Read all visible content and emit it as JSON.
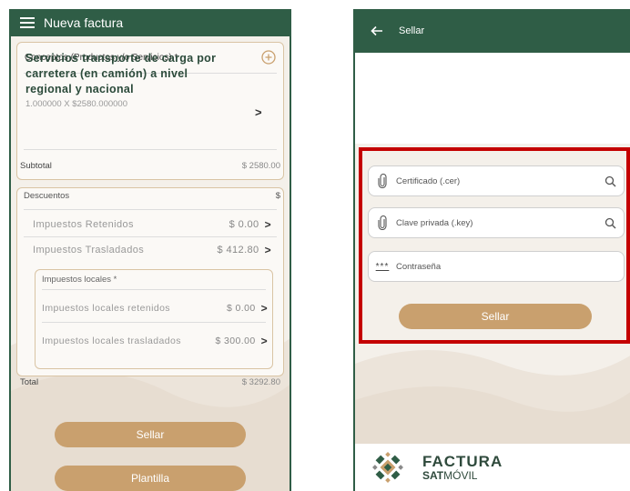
{
  "left": {
    "appbar": {
      "title": "Nueva factura",
      "menu_icon": "hamburger-menu-icon"
    },
    "concepts": {
      "header": "Conceptos (Productos y/o Servicios) *",
      "item_description": "Servicios transporte de carga por carretera (en camión) a nivel regional y nacional",
      "item_quantity_price": "1.000000 X $2580.000000"
    },
    "subtotal": {
      "label": "Subtotal",
      "value": "$ 2580.00"
    },
    "descuentos": {
      "label": "Descuentos",
      "value": "$"
    },
    "impuestos_retenidos": {
      "label": "Impuestos Retenidos",
      "value": "$ 0.00"
    },
    "impuestos_trasladados": {
      "label": "Impuestos Trasladados",
      "value": "$ 412.80"
    },
    "impuestos_locales": {
      "header": "Impuestos locales *",
      "retenidos_label": "Impuestos locales retenidos",
      "retenidos_value": "$ 0.00",
      "trasladados_label": "Impuestos locales trasladados",
      "trasladados_value": "$ 300.00"
    },
    "total": {
      "label": "Total",
      "value": "$ 3292.80"
    },
    "buttons": {
      "sellar": "Sellar",
      "plantilla": "Plantilla"
    }
  },
  "right": {
    "appbar": {
      "title": "Sellar",
      "back_icon": "arrow-left-icon"
    },
    "fields": {
      "certificado": "Certificado (.cer)",
      "clave_privada": "Clave privada (.key)",
      "contrasena": "Contraseña",
      "password_glyph": "***"
    },
    "sellar_button": "Sellar",
    "footer": {
      "brand_line1": "FACTURA",
      "brand_line2_bold": "SAT",
      "brand_line2": "MÓVIL"
    }
  },
  "colors": {
    "primary_green": "#2f5d46",
    "button_tan": "#c9a06e",
    "card_border": "#d9c4a4",
    "highlight_red": "#c40000"
  }
}
